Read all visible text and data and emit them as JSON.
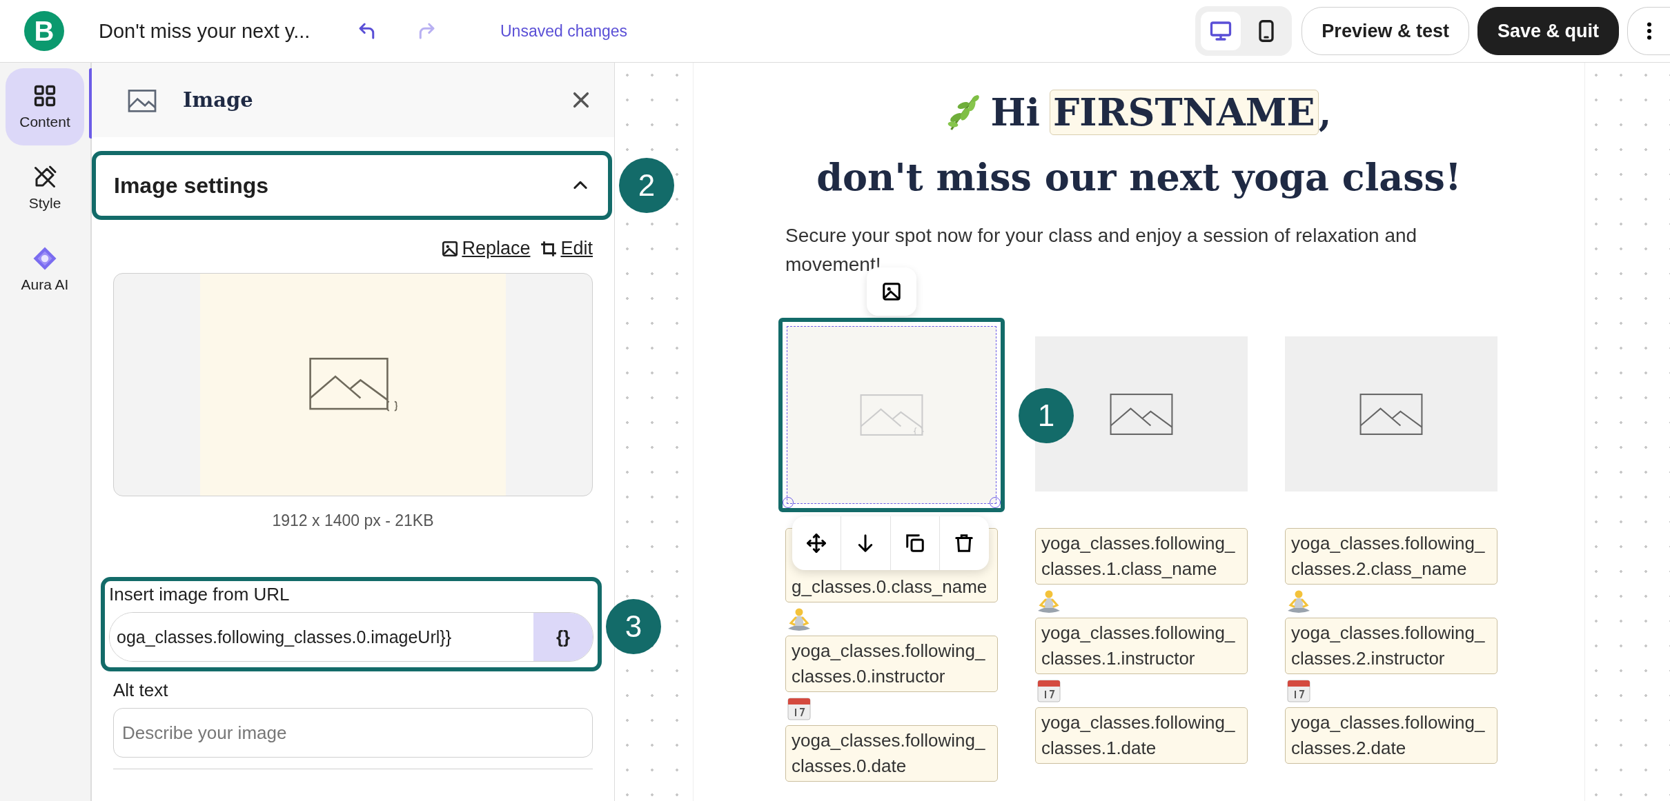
{
  "app": {
    "logo_letter": "B",
    "title": "Don't miss your next y...",
    "undo": {
      "disabled": false
    },
    "redo": {
      "disabled": true
    },
    "save_status": "Unsaved changes"
  },
  "view_toggle": [
    {
      "kind": "desktop",
      "selected": true
    },
    {
      "kind": "mobile",
      "selected": false
    }
  ],
  "actions": [
    {
      "label": "Preview & test",
      "kind": "secondary"
    },
    {
      "label": "Save & quit",
      "kind": "primary"
    }
  ],
  "rail": [
    {
      "label": "Content",
      "kind": "grid",
      "selected": true
    },
    {
      "label": "Style",
      "kind": "brush",
      "selected": false
    },
    {
      "label": "Aura AI",
      "kind": "aura",
      "selected": false
    }
  ],
  "panel": {
    "title": "Image",
    "section": {
      "title": "Image settings",
      "expanded": true,
      "annotation": "2"
    },
    "links": [
      {
        "label": "Replace",
        "kind": "replace"
      },
      {
        "label": "Edit",
        "kind": "crop"
      }
    ],
    "image_info": "1912 x 1400 px - 21KB",
    "url_field": {
      "label": "Insert image from URL",
      "value": "oga_classes.following_classes.0.imageUrl}}",
      "variable_button": "{}",
      "annotation": "3"
    },
    "alt_field": {
      "label": "Alt text",
      "placeholder": "Describe your image"
    }
  },
  "email": {
    "greeting": "Hi",
    "firstname_tag": "FIRSTNAME",
    "greeting_end": ",",
    "headline": "don't miss our next yoga class!",
    "intro": "Secure your spot now for your class and enjoy a session of relaxation and movement!",
    "columns": [
      {
        "selected": true,
        "annotation": "1",
        "class_name": "g_classes.0.class_name",
        "instructor": "yoga_classes.following_classes.0.instructor",
        "date": "yoga_classes.following_classes.0.date"
      },
      {
        "selected": false,
        "class_name": "yoga_classes.following_classes.1.class_name",
        "instructor": "yoga_classes.following_classes.1.instructor",
        "date": "yoga_classes.following_classes.1.date"
      },
      {
        "selected": false,
        "class_name": "yoga_classes.following_classes.2.class_name",
        "instructor": "yoga_classes.following_classes.2.instructor",
        "date": "yoga_classes.following_classes.2.date"
      }
    ]
  }
}
